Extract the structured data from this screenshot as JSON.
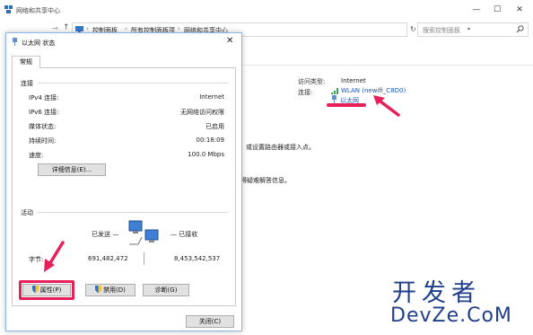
{
  "window": {
    "title": "网络和共享中心",
    "controls": {
      "min": "—",
      "max": "☐",
      "close": "✕"
    }
  },
  "addressbar": {
    "crumbs": [
      "控制面板",
      "所有控制面板项",
      "网络和共享中心"
    ],
    "search_placeholder": "搜索控制面板"
  },
  "network": {
    "access_type_label": "访问类型:",
    "access_type_value": "Internet",
    "connections_label": "连接:",
    "wlan_link": "WLAN (newifi_C8D0)",
    "ethernet_link": "以太网",
    "desc_partial_1": "或设置路由器或接入点。",
    "desc_partial_2": "得疑难解答信息。"
  },
  "dialog": {
    "title": "以太网 状态",
    "tab_general": "常规",
    "section_connection": "连接",
    "rows": [
      {
        "label": "IPv4 连接:",
        "value": "Internet"
      },
      {
        "label": "IPv6 连接:",
        "value": "无网络访问权限"
      },
      {
        "label": "媒体状态:",
        "value": "已启用"
      },
      {
        "label": "持续时间:",
        "value": "00:18:09"
      },
      {
        "label": "速度:",
        "value": "100.0 Mbps"
      }
    ],
    "details_button": "详细信息(E)...",
    "section_activity": "活动",
    "sent_label": "已发送 —",
    "received_label": "— 已接收",
    "bytes_label": "字节:",
    "bytes_sent": "691,482,472",
    "bytes_received": "8,453,542,537",
    "properties_button": "属性(P)",
    "disable_button": "禁用(D)",
    "diagnose_button": "诊断(G)",
    "close_button": "关闭(C)"
  },
  "watermark": {
    "line1": "开发者",
    "line2": "DevZe.CoM"
  },
  "colors": {
    "highlight": "#e8205a",
    "link": "#1a55c4",
    "watermark": "#1f3f8a"
  }
}
